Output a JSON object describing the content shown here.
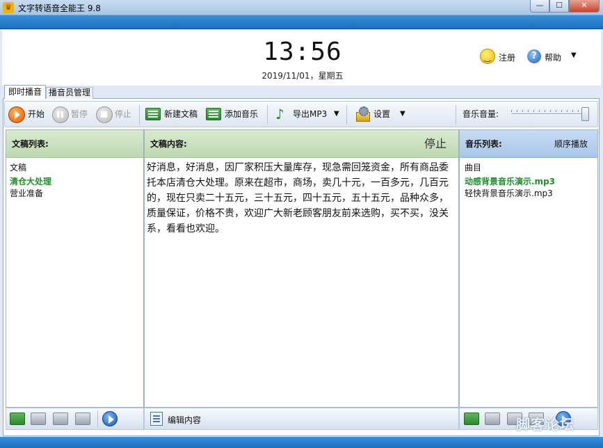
{
  "window": {
    "title": "文字转语音全能王 9.8",
    "app_icon_glyph": "♛",
    "min_glyph": "—",
    "max_glyph": "☐",
    "close_glyph": "✕"
  },
  "header": {
    "clock": "13:56",
    "date": "2019/11/01，星期五",
    "register_label": "注册",
    "help_icon_glyph": "?",
    "help_label": "帮助",
    "help_caret": "▼"
  },
  "tabs": [
    {
      "label": "即时播音"
    },
    {
      "label": "播音员管理"
    }
  ],
  "toolbar": {
    "start_label": "开始",
    "pause_label": "暂停",
    "stop_label": "停止",
    "new_doc_label": "新建文稿",
    "add_music_label": "添加音乐",
    "export_icon_glyph": "♪",
    "export_label": "导出MP3",
    "export_caret": "▼",
    "settings_label": "设置",
    "settings_caret": "▼",
    "volume_label": "音乐音量:",
    "volume_level": 1.0
  },
  "doc_list": {
    "title": "文稿列表:",
    "column_header": "文稿",
    "items": [
      {
        "label": "清仓大处理",
        "active": true
      },
      {
        "label": "营业准备",
        "active": false
      }
    ]
  },
  "content": {
    "title": "文稿内容:",
    "status": "停止",
    "text": "好消息，好消息，因厂家积压大量库存，现急需回笼资金，所有商品委托本店清仓大处理。原来在超市，商场，卖几十元，一百多元，几百元的，现在只卖二十五元，三十五元，四十五元，五十五元，品种众多，质量保证，价格不贵，欢迎广大新老顾客朋友前来选购，买不买，没关系，看看也欢迎。",
    "edit_label": "编辑内容"
  },
  "music_list": {
    "title": "音乐列表:",
    "play_mode": "顺序播放",
    "column_header": "曲目",
    "items": [
      {
        "label": "动感背景音乐演示.mp3",
        "active": true
      },
      {
        "label": "轻快背景音乐演示.mp3",
        "active": false
      }
    ]
  },
  "watermark": "脚客论坛",
  "colors": {
    "accent_blue": "#1a6fc0",
    "active_green": "#1f8f2a",
    "header_green": "#bdd8b0",
    "header_blue": "#a8c6ea"
  }
}
